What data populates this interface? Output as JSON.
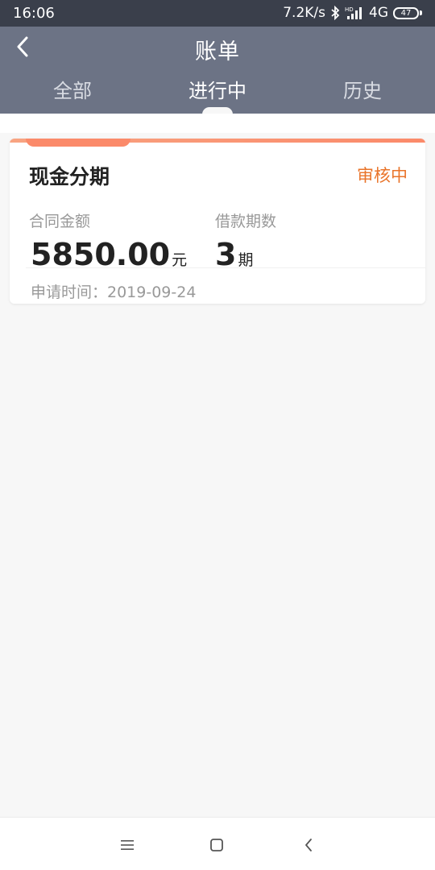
{
  "statusbar": {
    "time": "16:06",
    "net_speed": "7.2K/s",
    "network": "4G",
    "battery": "47",
    "icons": [
      "bluetooth-icon",
      "hd-signal-icon",
      "battery-icon"
    ]
  },
  "header": {
    "title": "账单",
    "back_icon": "chevron-left-icon",
    "tabs": [
      {
        "label": "全部"
      },
      {
        "label": "进行中"
      },
      {
        "label": "历史"
      }
    ],
    "active_tab": "进行中",
    "bg_color": "#6c7385"
  },
  "bill_card": {
    "name": "现金分期",
    "status": "审核中",
    "status_color": "#e9742a",
    "accent_color": "#fb8a6a",
    "contract_amount_label": "合同金额",
    "contract_amount": "5850.00",
    "contract_amount_unit": "元",
    "periods_label": "借款期数",
    "periods": "3",
    "periods_unit": "期",
    "apply_date": "申请时间：2019-09-24"
  },
  "navbar": {
    "icons": [
      "menu-icon",
      "home-square-icon",
      "back-chevron-icon"
    ]
  }
}
